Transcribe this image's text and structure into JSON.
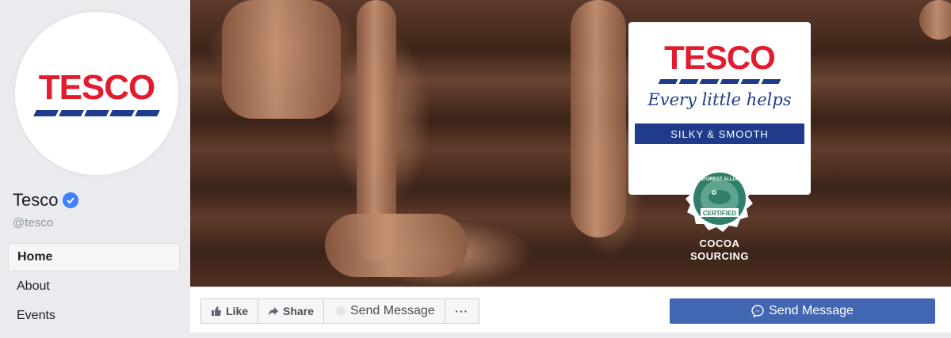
{
  "page": {
    "name": "Tesco",
    "handle": "@tesco",
    "logo_text": "TESCO"
  },
  "nav": {
    "items": [
      {
        "label": "Home",
        "active": true
      },
      {
        "label": "About",
        "active": false
      },
      {
        "label": "Events",
        "active": false
      }
    ]
  },
  "cover": {
    "brand_logo": "TESCO",
    "tagline": "Every little helps",
    "variant": "SILKY & SMOOTH",
    "seal_line1": "COCOA",
    "seal_line2": "SOURCING",
    "seal_ring_text": "RAINFOREST ALLIANCE",
    "seal_center_text": "CERTIFIED"
  },
  "actions": {
    "like": "Like",
    "share": "Share",
    "send_message": "Send Message",
    "more": "···",
    "primary_send_message": "Send Message"
  },
  "colors": {
    "tesco_red": "#e21b2e",
    "tesco_blue": "#1f3b8a",
    "facebook_blue": "#4267b2",
    "verified_blue": "#4080ff"
  },
  "icons": [
    "verified-badge-icon",
    "like-thumb-icon",
    "share-arrow-icon",
    "messenger-icon",
    "more-dots-icon",
    "rainforest-frog-icon"
  ]
}
